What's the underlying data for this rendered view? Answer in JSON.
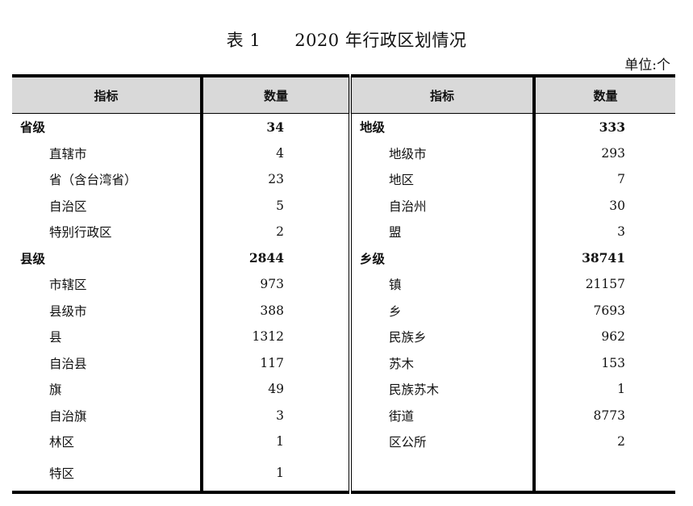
{
  "title": {
    "table_no": "表 1",
    "text": "2020 年行政区划情况"
  },
  "unit": "单位:个",
  "headers": [
    "指标",
    "数量",
    "指标",
    "数量"
  ],
  "rows": [
    {
      "left": {
        "label": "省级",
        "value": "34",
        "group": true
      },
      "right": {
        "label": "地级",
        "value": "333",
        "group": true
      }
    },
    {
      "left": {
        "label": "直辖市",
        "value": "4"
      },
      "right": {
        "label": "地级市",
        "value": "293"
      }
    },
    {
      "left": {
        "label": "省（含台湾省）",
        "value": "23"
      },
      "right": {
        "label": "地区",
        "value": "7"
      }
    },
    {
      "left": {
        "label": "自治区",
        "value": "5"
      },
      "right": {
        "label": "自治州",
        "value": "30"
      }
    },
    {
      "left": {
        "label": "特别行政区",
        "value": "2"
      },
      "right": {
        "label": "盟",
        "value": "3"
      }
    },
    {
      "left": {
        "label": "县级",
        "value": "2844",
        "group": true
      },
      "right": {
        "label": "乡级",
        "value": "38741",
        "group": true
      }
    },
    {
      "left": {
        "label": "市辖区",
        "value": "973"
      },
      "right": {
        "label": "镇",
        "value": "21157"
      }
    },
    {
      "left": {
        "label": "县级市",
        "value": "388"
      },
      "right": {
        "label": "乡",
        "value": "7693"
      }
    },
    {
      "left": {
        "label": "县",
        "value": "1312"
      },
      "right": {
        "label": "民族乡",
        "value": "962"
      }
    },
    {
      "left": {
        "label": "自治县",
        "value": "117"
      },
      "right": {
        "label": "苏木",
        "value": "153"
      }
    },
    {
      "left": {
        "label": "旗",
        "value": "49"
      },
      "right": {
        "label": "民族苏木",
        "value": "1"
      }
    },
    {
      "left": {
        "label": "自治旗",
        "value": "3"
      },
      "right": {
        "label": "街道",
        "value": "8773"
      }
    },
    {
      "left": {
        "label": "林区",
        "value": "1"
      },
      "right": {
        "label": "区公所",
        "value": "2"
      }
    },
    {
      "left": {
        "label": "特区",
        "value": "1"
      },
      "right": {
        "label": "",
        "value": ""
      }
    }
  ]
}
